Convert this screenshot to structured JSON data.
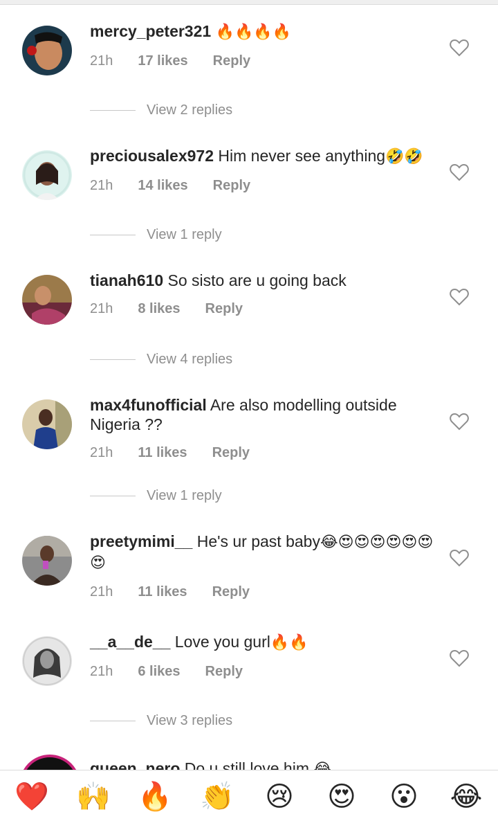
{
  "comments": [
    {
      "username": "mercy_peter321",
      "text": "",
      "emoji": "🔥🔥🔥🔥",
      "time": "21h",
      "likes": "17 likes",
      "reply": "Reply",
      "replies": "View 2 replies",
      "avatar_bg": "#1d3a4c",
      "avatar_fg": "#c98a60"
    },
    {
      "username": "preciousalex972",
      "text": "Him never see anything",
      "emoji": "🤣🤣",
      "time": "21h",
      "likes": "14 likes",
      "reply": "Reply",
      "replies": "View 1 reply",
      "avatar_bg": "#dff3ef",
      "avatar_fg": "#4a3028"
    },
    {
      "username": "tianah610",
      "text": "So sisto are u going back",
      "emoji": "",
      "time": "21h",
      "likes": "8 likes",
      "reply": "Reply",
      "replies": "View 4 replies",
      "avatar_bg": "#9b7a4a",
      "avatar_fg": "#b04068"
    },
    {
      "username": "max4funofficial",
      "text": "Are also modelling outside Nigeria ??",
      "emoji": "",
      "time": "21h",
      "likes": "11 likes",
      "reply": "Reply",
      "replies": "View 1 reply",
      "avatar_bg": "#d9ccaa",
      "avatar_fg": "#1f3e8c"
    },
    {
      "username": "preetymimi__",
      "text": "He's ur past baby",
      "emoji": "😂😍😍😍😍😍😍😍",
      "time": "21h",
      "likes": "11 likes",
      "reply": "Reply",
      "replies": "",
      "avatar_bg": "#8c8c8c",
      "avatar_fg": "#5a3a2a"
    },
    {
      "username": "__a__de__",
      "text": "Love you gurl",
      "emoji": "🔥🔥",
      "time": "21h",
      "likes": "6 likes",
      "reply": "Reply",
      "replies": "View 3 replies",
      "avatar_bg": "#e6e6e6",
      "avatar_fg": "#3a3a3a"
    },
    {
      "username": "queen_nero",
      "text": "Do u still love him",
      "emoji": "😂"
    }
  ],
  "reactions": [
    "❤️",
    "🙌",
    "🔥",
    "👏",
    "😢",
    "😍",
    "😮",
    "😂"
  ],
  "colors": {
    "text": "#262626",
    "muted": "#8e8e8e",
    "divider": "#dbdbdb"
  }
}
